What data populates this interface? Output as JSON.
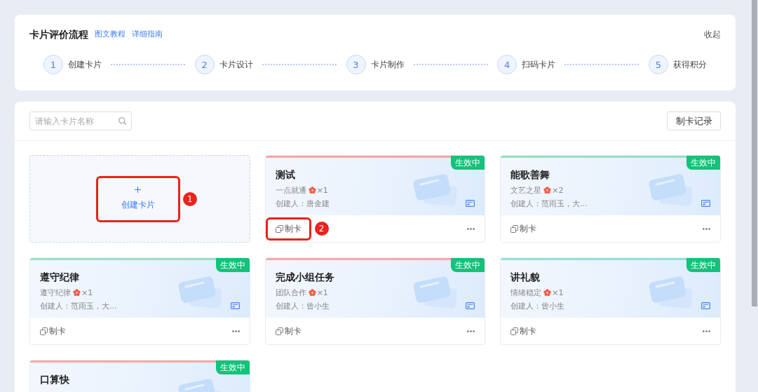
{
  "header": {
    "title": "卡片评价流程",
    "links": [
      {
        "label": "图文教程"
      },
      {
        "label": "详细指南"
      }
    ],
    "collapse": "收起",
    "steps": [
      {
        "number": "1",
        "label": "创建卡片"
      },
      {
        "number": "2",
        "label": "卡片设计"
      },
      {
        "number": "3",
        "label": "卡片制作"
      },
      {
        "number": "4",
        "label": "扫码卡片"
      },
      {
        "number": "5",
        "label": "获得积分"
      }
    ]
  },
  "toolbar": {
    "search": {
      "placeholder": "请输入卡片名称"
    },
    "history_button": "制卡记录"
  },
  "create_tile": {
    "label": "创建卡片",
    "annotation": "1"
  },
  "cards": [
    {
      "title": "测试",
      "award": "一点就通",
      "count": "×1",
      "creator": "创建人：唐金建",
      "status": "生效中",
      "color": "#f5a7a5",
      "action": "制卡",
      "annotation": "2"
    },
    {
      "title": "能歌善舞",
      "award": "文艺之星",
      "count": "×2",
      "creator": "创建人：范雨玉，大...",
      "status": "生效中",
      "color": "#98dfc1",
      "action": "制卡"
    },
    {
      "title": "遵守纪律",
      "award": "遵守纪律",
      "count": "×1",
      "creator": "创建人：范雨玉，大...",
      "status": "生效中",
      "color": "#9fdfc4",
      "action": "制卡"
    },
    {
      "title": "完成小组任务",
      "award": "团队合作",
      "count": "×1",
      "creator": "创建人：曾小生",
      "status": "生效中",
      "color": "#f7aaa8",
      "action": "制卡"
    },
    {
      "title": "讲礼貌",
      "award": "情绪稳定",
      "count": "×1",
      "creator": "创建人：曾小生",
      "status": "生效中",
      "color": "#95e0dc",
      "action": "制卡"
    },
    {
      "title": "口算快",
      "status": "生效中",
      "color": "#f7aaa8"
    }
  ]
}
